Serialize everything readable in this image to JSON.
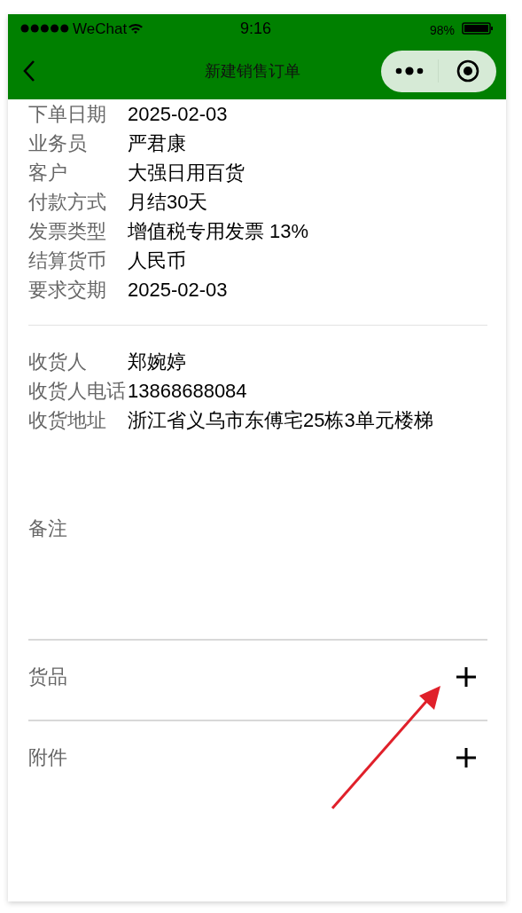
{
  "status_bar": {
    "carrier": "WeChat",
    "time": "9:16",
    "battery": "98%"
  },
  "nav": {
    "title": "新建销售订单"
  },
  "order_fields": [
    {
      "label": "下单日期",
      "value": "2025-02-03"
    },
    {
      "label": "业务员",
      "value": "严君康"
    },
    {
      "label": "客户",
      "value": "大强日用百货"
    },
    {
      "label": "付款方式",
      "value": "月结30天"
    },
    {
      "label": "发票类型",
      "value": "增值税专用发票 13%"
    },
    {
      "label": "结算货币",
      "value": "人民币"
    },
    {
      "label": "要求交期",
      "value": "2025-02-03"
    }
  ],
  "shipping_fields": [
    {
      "label": "收货人",
      "value": "郑婉婷"
    },
    {
      "label": "收货人电话",
      "value": "13868688084"
    },
    {
      "label": "收货地址",
      "value": "浙江省义乌市东傅宅25栋3单元楼梯"
    }
  ],
  "remark": {
    "label": "备注"
  },
  "sections": [
    {
      "label": "货品"
    },
    {
      "label": "附件"
    }
  ]
}
